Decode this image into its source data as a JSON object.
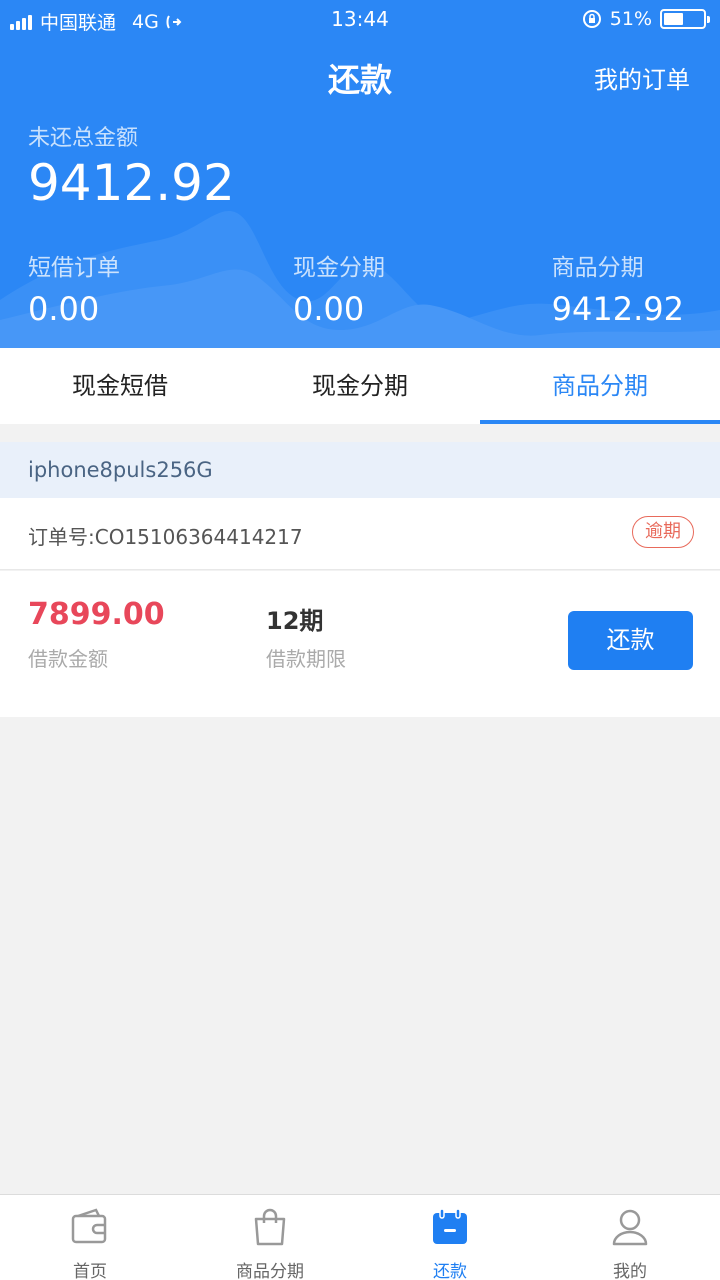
{
  "status_bar": {
    "carrier": "中国联通",
    "network": "4G",
    "time": "13:44",
    "battery": "51%",
    "battery_level": 0.51
  },
  "nav": {
    "title": "还款",
    "right_link": "我的订单"
  },
  "summary": {
    "total_label": "未还总金额",
    "total_value": "9412.92",
    "items": [
      {
        "label": "短借订单",
        "value": "0.00"
      },
      {
        "label": "现金分期",
        "value": "0.00"
      },
      {
        "label": "商品分期",
        "value": "9412.92"
      }
    ]
  },
  "tabs": [
    {
      "label": "现金短借",
      "active": false
    },
    {
      "label": "现金分期",
      "active": false
    },
    {
      "label": "商品分期",
      "active": true
    }
  ],
  "order": {
    "product": "iphone8puls256G",
    "order_no": "订单号:CO15106364414217",
    "status_badge": "逾期",
    "amount": "7899.00",
    "amount_label": "借款金额",
    "term": "12期",
    "term_label": "借款期限",
    "repay_button": "还款"
  },
  "tabbar": [
    {
      "label": "首页",
      "icon": "wallet-icon",
      "active": false
    },
    {
      "label": "商品分期",
      "icon": "shopping-bag-icon",
      "active": false
    },
    {
      "label": "还款",
      "icon": "calendar-icon",
      "active": true
    },
    {
      "label": "我的",
      "icon": "user-icon",
      "active": false
    }
  ],
  "colors": {
    "primary": "#2b87f5",
    "button": "#1f7ff2",
    "amount_red": "#e8475a",
    "overdue": "#e86a5b"
  }
}
